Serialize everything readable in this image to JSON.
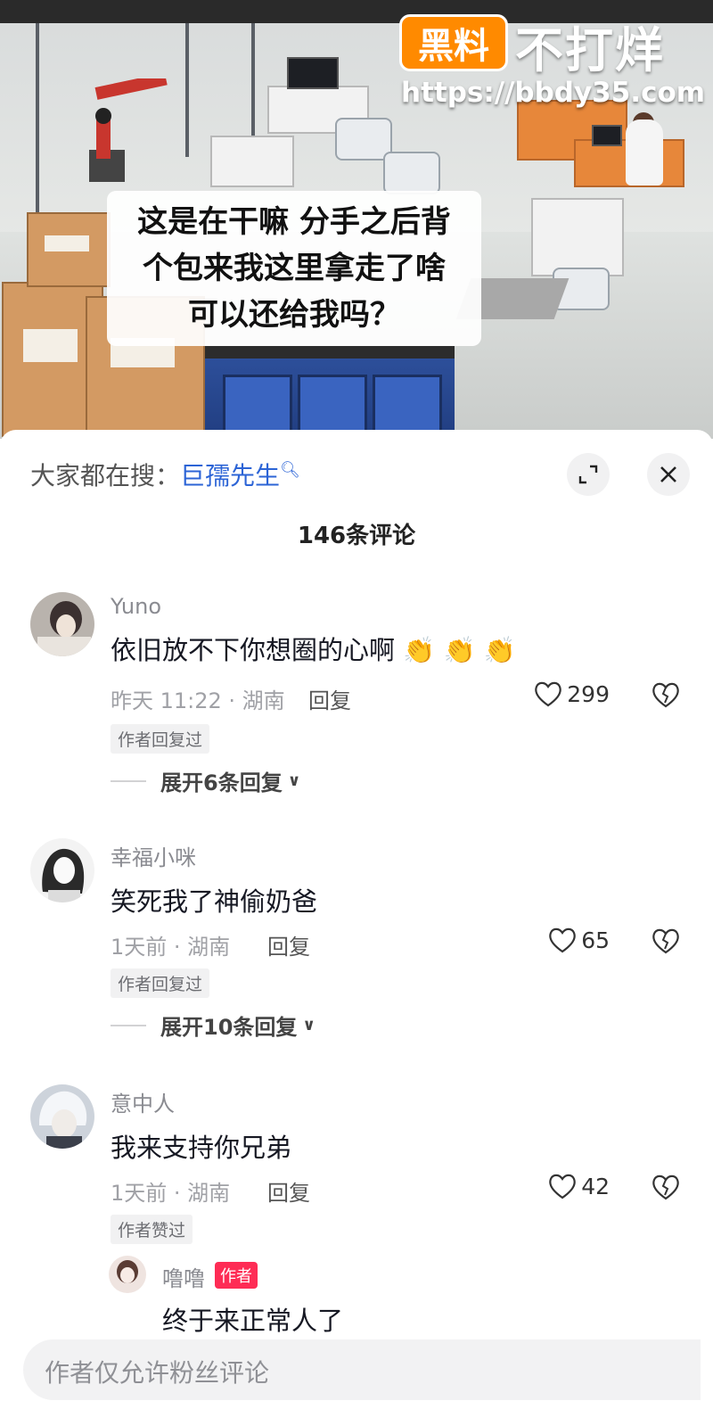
{
  "video": {
    "caption_lines": [
      "这是在干嘛 分手之后背",
      "个包来我这里拿走了啥",
      "可以还给我吗？"
    ],
    "watermark_badge": "黑料",
    "watermark_text": "不打烊",
    "watermark_url": "https://bbdy35.com"
  },
  "sheet": {
    "search_prefix": "大家都在搜：",
    "search_term": "巨孺先生",
    "comment_count": "146条评论",
    "icons": {
      "expand": "expand-icon",
      "close": "close-icon",
      "like": "heart-icon",
      "dislike": "broken-heart-icon"
    }
  },
  "comments": [
    {
      "username": "Yuno",
      "text": "依旧放不下你想圈的心啊",
      "emoji": "👏 👏 👏",
      "time_location": "昨天 11:22 · 湖南",
      "reply_label": "回复",
      "likes": "299",
      "tag": "作者回复过",
      "expand": "展开6条回复"
    },
    {
      "username": "幸福小咪",
      "text": "笑死我了神偷奶爸",
      "time_location": "1天前 · 湖南",
      "reply_label": "回复",
      "likes": "65",
      "tag": "作者回复过",
      "expand": "展开10条回复"
    },
    {
      "username": "意中人",
      "text": "我来支持你兄弟",
      "time_location": "1天前 · 湖南",
      "reply_label": "回复",
      "likes": "42",
      "tag": "作者赞过",
      "sub_reply": {
        "username": "噜噜",
        "badge": "作者",
        "text": "终于来正常人了"
      }
    }
  ],
  "input": {
    "placeholder": "作者仅允许粉丝评论"
  },
  "colors": {
    "accent_link": "#2c64d6",
    "author_badge": "#fe2c55",
    "watermark_orange": "#ff8a00"
  }
}
